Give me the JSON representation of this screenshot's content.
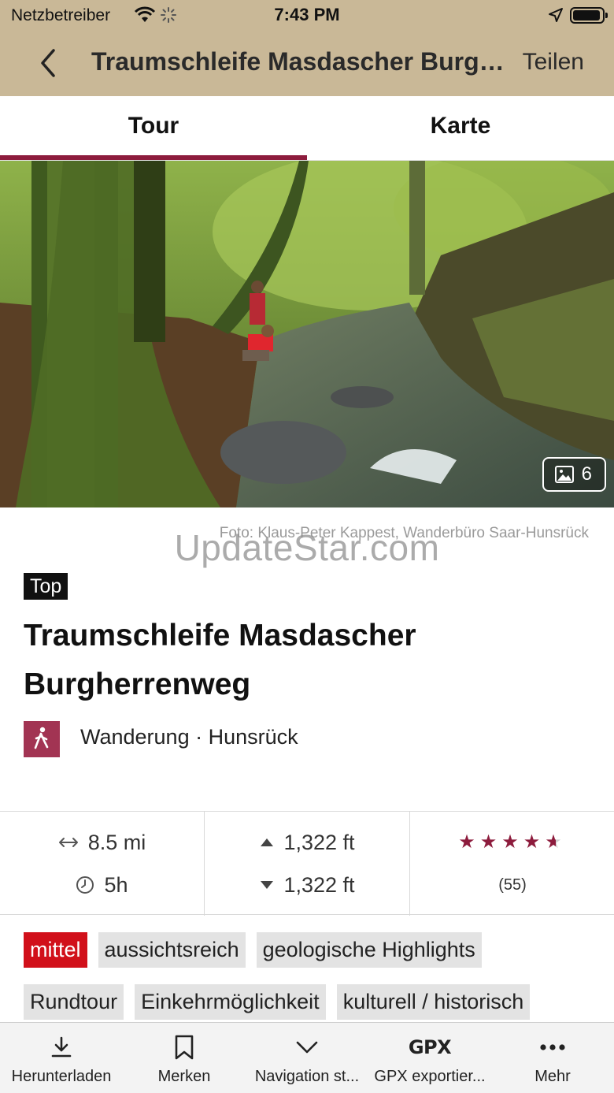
{
  "status_bar": {
    "carrier": "Netzbetreiber",
    "time": "7:43 PM"
  },
  "nav": {
    "title": "Traumschleife Masdascher Burgh...",
    "share_label": "Teilen"
  },
  "tabs": [
    {
      "label": "Tour",
      "active": true
    },
    {
      "label": "Karte",
      "active": false
    }
  ],
  "hero": {
    "photo_count": "6",
    "credit": "Foto: Klaus-Peter Kappest, Wanderbüro Saar-Hunsrück"
  },
  "watermark": "UpdateStar.com",
  "tour": {
    "badge": "Top",
    "title": "Traumschleife Masdascher Burgherrenweg",
    "category_line": "Wanderung · Hunsrück"
  },
  "stats": {
    "distance": "8.5 mi",
    "duration": "5h",
    "ascent": "1,322 ft",
    "descent": "1,322 ft",
    "rating_stars": 4.5,
    "rating_stars_glyphs": "★★★★★",
    "rating_count": "(55)"
  },
  "tags": {
    "row1": [
      "mittel",
      "aussichtsreich",
      "geologische Highlights"
    ],
    "row2": [
      "Rundtour",
      "Einkehrmöglichkeit",
      "kulturell / historisch"
    ]
  },
  "toolbar": [
    {
      "label": "Herunterladen",
      "icon": "download-icon"
    },
    {
      "label": "Merken",
      "icon": "bookmark-icon"
    },
    {
      "label": "Navigation st...",
      "icon": "chevron-down-icon"
    },
    {
      "label": "GPX exportier...",
      "icon": "gpx-icon",
      "icon_text": "GPX"
    },
    {
      "label": "Mehr",
      "icon": "more-icon"
    }
  ],
  "colors": {
    "header_bg": "#c9b897",
    "accent": "#8d1c3d",
    "level_red": "#d1101a",
    "category_icon_bg": "#a23453"
  }
}
